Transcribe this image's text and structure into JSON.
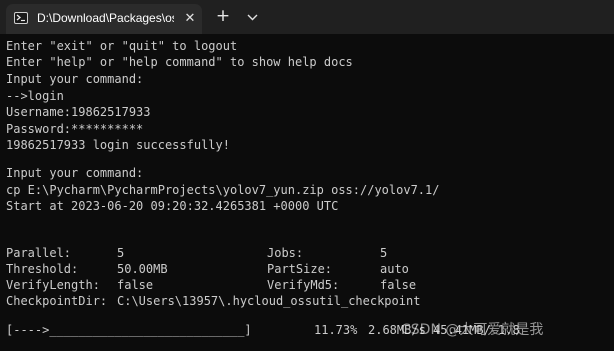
{
  "tab": {
    "title": "D:\\Download\\Packages\\oss_w",
    "close_glyph": "✕",
    "new_tab_glyph": "+",
    "icon": "terminal-icon"
  },
  "terminal": {
    "lines": [
      "Enter \"exit\" or \"quit\" to logout",
      "Enter \"help\" or \"help command\" to show help docs",
      "Input your command:",
      "-->login",
      "Username:19862517933",
      "Password:**********",
      "19862517933 login successfully!",
      "",
      "Input your command:",
      "cp E:\\Pycharm\\PycharmProjects\\yolov7_yun.zip oss://yolov7.1/",
      "Start at 2023-06-20 09:20:32.4265381 +0000 UTC"
    ],
    "stats": {
      "parallel_label": "Parallel:",
      "parallel_value": "5",
      "jobs_label": "Jobs:",
      "jobs_value": "5",
      "threshold_label": "Threshold:",
      "threshold_value": "50.00MB",
      "partsize_label": "PartSize:",
      "partsize_value": "auto",
      "verifylength_label": "VerifyLength:",
      "verifylength_value": "false",
      "verifymd5_label": "VerifyMd5:",
      "verifymd5_value": "false",
      "checkpointdir_label": "CheckpointDir:",
      "checkpointdir_value": "C:\\Users\\13957\\.hycloud_ossutil_checkpoint"
    },
    "progress": {
      "bar_text": "[---->___________________________]",
      "percent_text": "11.73%",
      "rest_text": "2.68MB/s 45.41MB/ 1.8",
      "percent": 11.73
    }
  },
  "watermark": "CSDN @大可爱就是我",
  "colors": {
    "terminal_bg": "#0c0c0c",
    "text": "#cccccc",
    "titlebar_bg": "#202020",
    "tab_bg": "#2b2b2b"
  }
}
